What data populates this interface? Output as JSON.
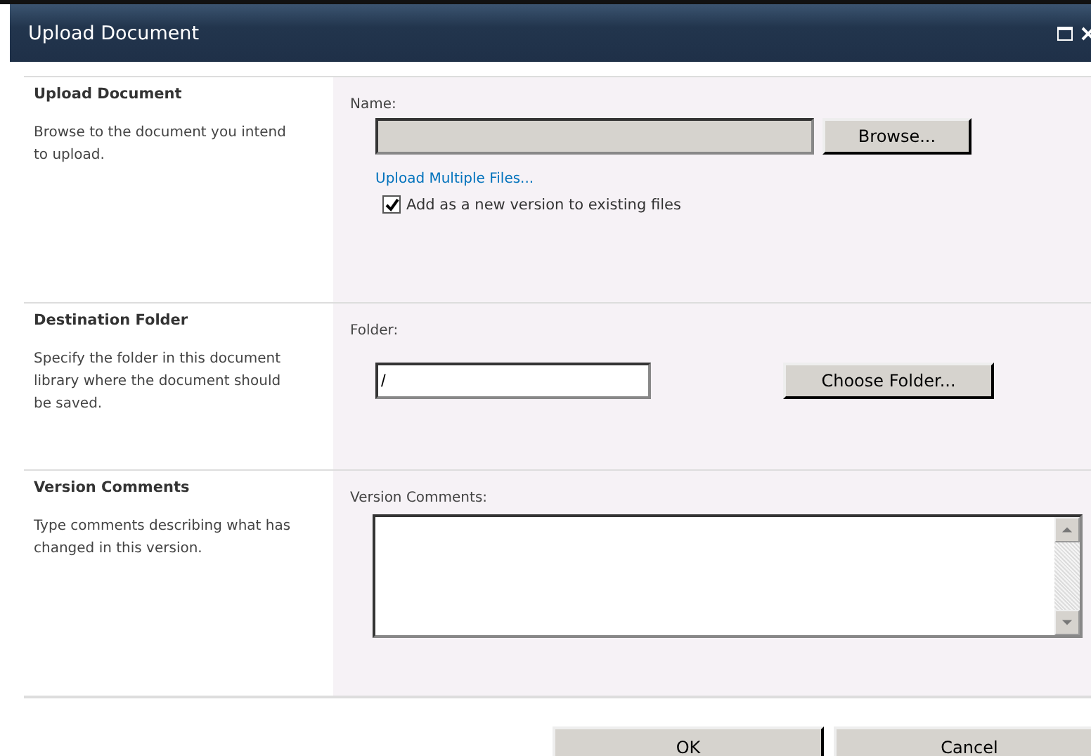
{
  "window": {
    "title": "Upload Document"
  },
  "sections": [
    {
      "kind": "file",
      "heading": "Upload Document",
      "description": "Browse to the document you intend to upload.",
      "field_label": "Name:",
      "button": "Browse...",
      "link": "Upload Multiple Files...",
      "checkbox": {
        "label": "Add as a new version to existing files",
        "checked": true
      }
    },
    {
      "kind": "folder",
      "heading": "Destination Folder",
      "description": "Specify the folder in this document library where the document should be saved.",
      "field_label": "Folder:",
      "value": "/",
      "button": "Choose Folder..."
    },
    {
      "kind": "comments",
      "heading": "Version Comments",
      "description": "Type comments describing what has changed in this version.",
      "field_label": "Version Comments:"
    }
  ],
  "buttons": [
    "OK",
    "Cancel"
  ]
}
